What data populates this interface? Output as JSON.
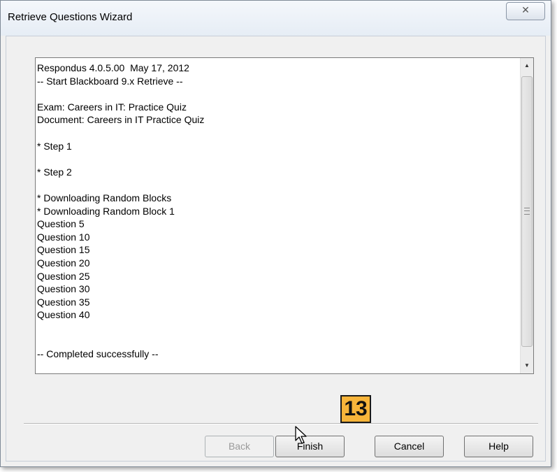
{
  "window": {
    "title": "Retrieve Questions Wizard",
    "close_glyph": "✕"
  },
  "log": {
    "lines": [
      "Respondus 4.0.5.00  May 17, 2012",
      "-- Start Blackboard 9.x Retrieve --",
      "",
      "Exam: Careers in IT: Practice Quiz",
      "Document: Careers in IT Practice Quiz",
      "",
      "* Step 1",
      "",
      "* Step 2",
      "",
      "* Downloading Random Blocks",
      "* Downloading Random Block 1",
      "Question 5",
      "Question 10",
      "Question 15",
      "Question 20",
      "Question 25",
      "Question 30",
      "Question 35",
      "Question 40",
      "",
      "",
      "-- Completed successfully --"
    ]
  },
  "buttons": {
    "back": "Back",
    "finish": "Finish",
    "cancel": "Cancel",
    "help": "Help"
  },
  "callout": {
    "number": "13",
    "color": "#f7b43a"
  },
  "icons": {
    "scroll_up": "scroll-up-arrow-icon",
    "scroll_down": "scroll-down-arrow-icon",
    "cursor": "mouse-pointer-icon"
  }
}
